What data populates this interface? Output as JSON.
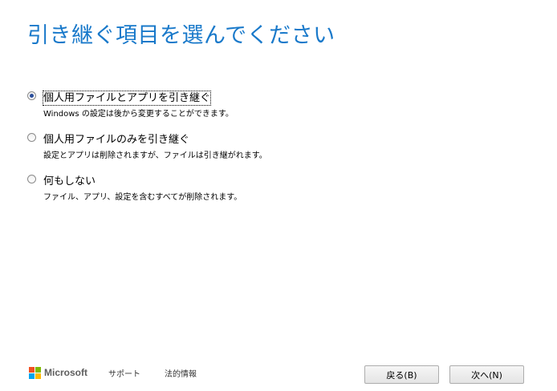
{
  "title": "引き継ぐ項目を選んでください",
  "options": [
    {
      "label": "個人用ファイルとアプリを引き継ぐ",
      "description": "Windows の設定は後から変更することができます。",
      "selected": true
    },
    {
      "label": "個人用ファイルのみを引き継ぐ",
      "description": "設定とアプリは削除されますが、ファイルは引き継がれます。",
      "selected": false
    },
    {
      "label": "何もしない",
      "description": "ファイル、アプリ、設定を含むすべてが削除されます。",
      "selected": false
    }
  ],
  "footer": {
    "brand": "Microsoft",
    "support_link": "サポート",
    "legal_link": "法的情報"
  },
  "buttons": {
    "back": "戻る(B)",
    "next": "次へ(N)"
  },
  "colors": {
    "title": "#1979ca",
    "logo_red": "#f25022",
    "logo_green": "#7fba00",
    "logo_blue": "#00a4ef",
    "logo_yellow": "#ffb900"
  }
}
